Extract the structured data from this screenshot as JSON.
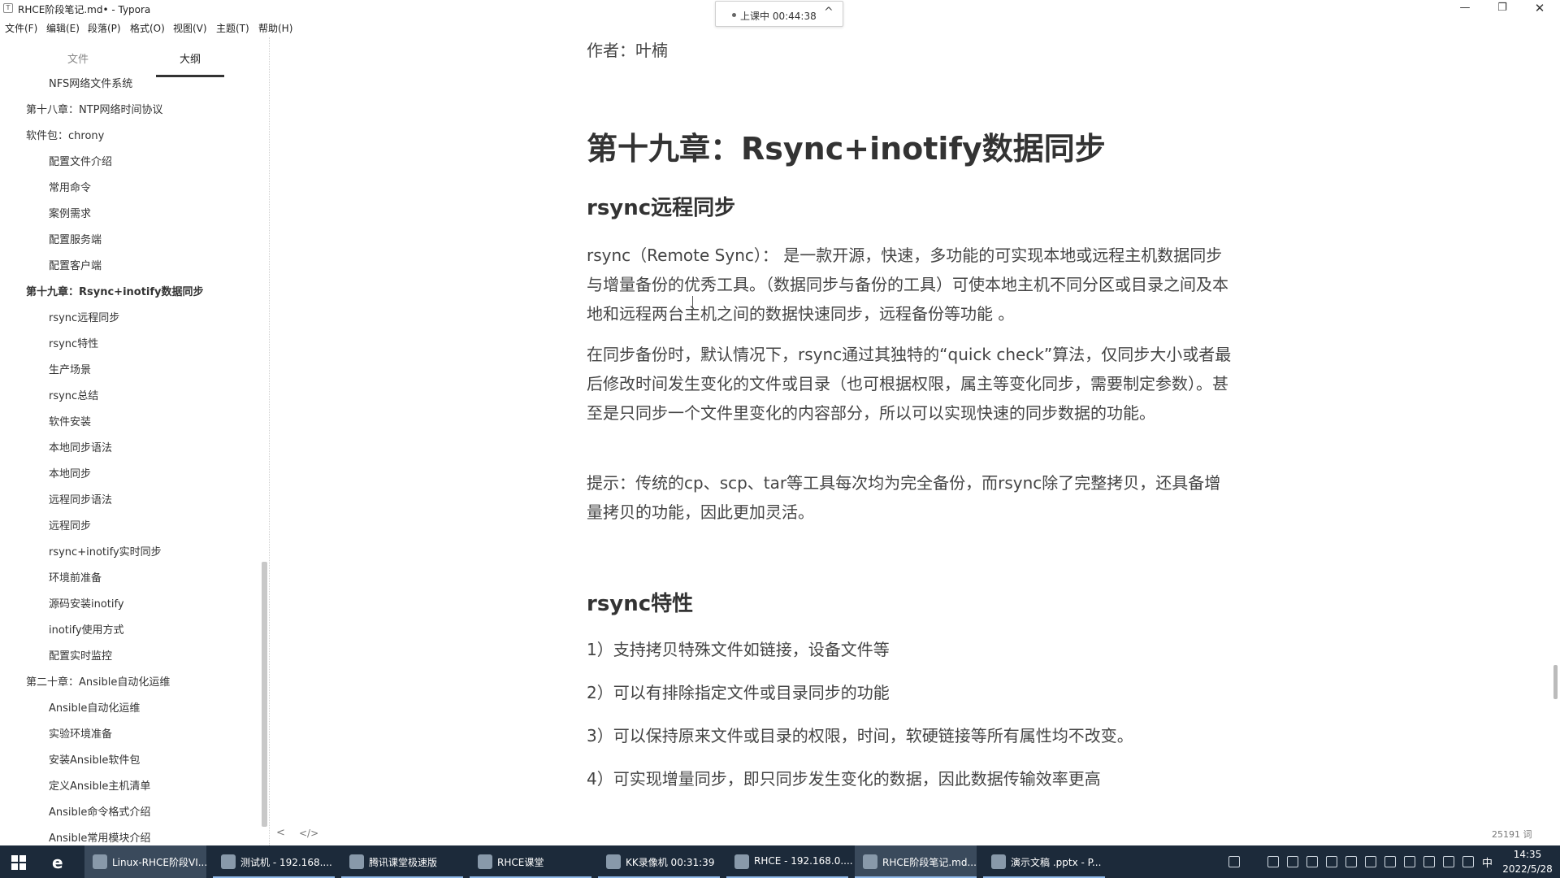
{
  "window": {
    "title": "RHCE阶段笔记.md• - Typora",
    "minimize": "—",
    "maximize": "❐",
    "close": "✕"
  },
  "class_status": {
    "label": "上课中 00:44:38",
    "chevron": "^"
  },
  "menu": [
    "文件(F)",
    "编辑(E)",
    "段落(P)",
    "格式(O)",
    "视图(V)",
    "主题(T)",
    "帮助(H)"
  ],
  "sidebar": {
    "tabs": [
      "文件",
      "大纲"
    ],
    "active_tab": "大纲",
    "items": [
      {
        "label": "NFS网络文件系统",
        "level": 2,
        "bold": false
      },
      {
        "label": "第十八章：NTP网络时间协议",
        "level": 1,
        "bold": false
      },
      {
        "label": "软件包：chrony",
        "level": 1,
        "bold": false
      },
      {
        "label": "配置文件介绍",
        "level": 2,
        "bold": false
      },
      {
        "label": "常用命令",
        "level": 2,
        "bold": false
      },
      {
        "label": "案例需求",
        "level": 2,
        "bold": false
      },
      {
        "label": "配置服务端",
        "level": 2,
        "bold": false
      },
      {
        "label": "配置客户端",
        "level": 2,
        "bold": false
      },
      {
        "label": "第十九章：Rsync+inotify数据同步",
        "level": 1,
        "bold": true
      },
      {
        "label": "rsync远程同步",
        "level": 2,
        "bold": false
      },
      {
        "label": "rsync特性",
        "level": 2,
        "bold": false
      },
      {
        "label": "生产场景",
        "level": 2,
        "bold": false
      },
      {
        "label": "rsync总结",
        "level": 2,
        "bold": false
      },
      {
        "label": "软件安装",
        "level": 2,
        "bold": false
      },
      {
        "label": "本地同步语法",
        "level": 2,
        "bold": false
      },
      {
        "label": "本地同步",
        "level": 2,
        "bold": false
      },
      {
        "label": "远程同步语法",
        "level": 2,
        "bold": false
      },
      {
        "label": "远程同步",
        "level": 2,
        "bold": false
      },
      {
        "label": "rsync+inotify实时同步",
        "level": 2,
        "bold": false
      },
      {
        "label": "环境前准备",
        "level": 2,
        "bold": false
      },
      {
        "label": "源码安装inotify",
        "level": 2,
        "bold": false
      },
      {
        "label": "inotify使用方式",
        "level": 2,
        "bold": false
      },
      {
        "label": "配置实时监控",
        "level": 2,
        "bold": false
      },
      {
        "label": "第二十章：Ansible自动化运维",
        "level": 1,
        "bold": false
      },
      {
        "label": "Ansible自动化运维",
        "level": 2,
        "bold": false
      },
      {
        "label": "实验环境准备",
        "level": 2,
        "bold": false
      },
      {
        "label": "安装Ansible软件包",
        "level": 2,
        "bold": false
      },
      {
        "label": "定义Ansible主机清单",
        "level": 2,
        "bold": false
      },
      {
        "label": "Ansible命令格式介绍",
        "level": 2,
        "bold": false
      },
      {
        "label": "Ansible常用模块介绍",
        "level": 2,
        "bold": false
      }
    ],
    "footer_back": "<",
    "footer_code": "</>"
  },
  "document": {
    "author": "作者：叶楠",
    "h1": "第十九章：Rsync+inotify数据同步",
    "h2_sync": "rsync远程同步",
    "para1": "rsync（Remote Sync）： 是一款开源，快速，多功能的可实现本地或远程主机数据同步与增量备份的优秀工具。（数据同步与备份的工具）可使本地主机不同分区或目录之间及本地和远程两台主机之间的数据快速同步，远程备份等功能 。",
    "para2": "在同步备份时，默认情况下，rsync通过其独特的“quick check”算法，仅同步大小或者最后修改时间发生变化的文件或目录（也可根据权限，属主等变化同步，需要制定参数）。甚至是只同步一个文件里变化的内容部分，所以可以实现快速的同步数据的功能。",
    "para3": "提示：传统的cp、scp、tar等工具每次均为完全备份，而rsync除了完整拷贝，还具备增量拷贝的功能，因此更加灵活。",
    "h2_features": "rsync特性",
    "features": [
      "1）支持拷贝特殊文件如链接，设备文件等",
      "2）可以有排除指定文件或目录同步的功能",
      "3）可以保持原来文件或目录的权限，时间，软硬链接等所有属性均不改变。",
      "4）可实现增量同步，即只同步发生变化的数据，因此数据传输效率更高"
    ],
    "word_count": "25191 词"
  },
  "taskbar": {
    "tasks": [
      {
        "label": "Linux-RHCE阶段VI...",
        "active": true
      },
      {
        "label": "测试机 - 192.168....",
        "active": false
      },
      {
        "label": "腾讯课堂极速版",
        "active": false
      },
      {
        "label": "RHCE课堂",
        "active": false
      },
      {
        "label": "KK录像机 00:31:39",
        "active": false
      },
      {
        "label": "RHCE - 192.168.0....",
        "active": false
      },
      {
        "label": "RHCE阶段笔记.md...",
        "active": false
      },
      {
        "label": "演示文稿 .pptx - P...",
        "active": false
      }
    ],
    "ime": "中",
    "time": "14:35",
    "date": "2022/5/28"
  }
}
